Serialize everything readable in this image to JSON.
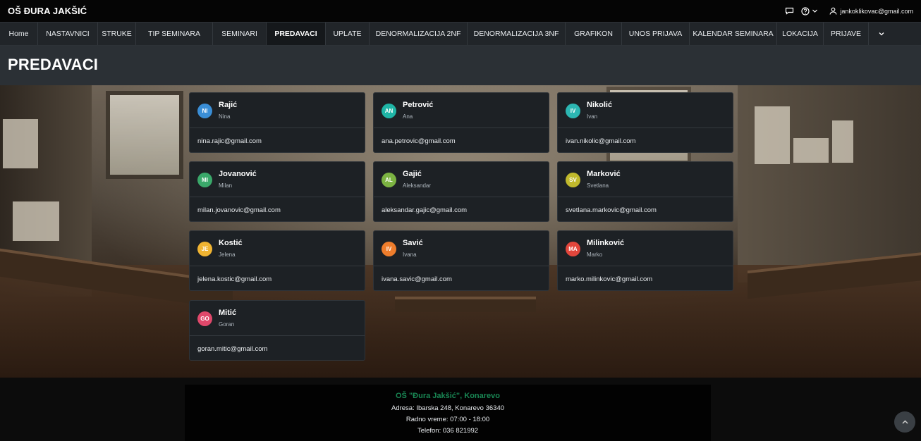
{
  "brand": "OŠ ĐURA JAKŠIĆ",
  "topbar": {
    "user_email": "jankoklikovac@gmail.com"
  },
  "nav": {
    "items": [
      {
        "label": "Home",
        "w": 54
      },
      {
        "label": "NASTAVNICI",
        "w": 85
      },
      {
        "label": "STRUKE",
        "w": 54
      },
      {
        "label": "TIP SEMINARA",
        "w": 109
      },
      {
        "label": "SEMINARI",
        "w": 76
      },
      {
        "label": "PREDAVACI",
        "w": 84,
        "active": true
      },
      {
        "label": "UPLATE",
        "w": 62
      },
      {
        "label": "DENORMALIZACIJA 2NF",
        "w": 139
      },
      {
        "label": "DENORMALIZACIJA 3NF",
        "w": 139
      },
      {
        "label": "GRAFIKON",
        "w": 80
      },
      {
        "label": "UNOS PRIJAVA",
        "w": 96
      },
      {
        "label": "KALENDAR SEMINARA",
        "w": 124
      },
      {
        "label": "LOKACIJA",
        "w": 66
      },
      {
        "label": "PRIJAVE",
        "w": 64
      }
    ]
  },
  "page": {
    "title": "PREDAVACI"
  },
  "lecturers": [
    {
      "initials": "NI",
      "lastname": "Rajić",
      "firstname": "Nina",
      "email": "nina.rajic@gmail.com",
      "color": "#3a8ed6"
    },
    {
      "initials": "AN",
      "lastname": "Petrović",
      "firstname": "Ana",
      "email": "ana.petrovic@gmail.com",
      "color": "#1fb5a6"
    },
    {
      "initials": "IV",
      "lastname": "Nikolić",
      "firstname": "Ivan",
      "email": "ivan.nikolic@gmail.com",
      "color": "#2cb6b2"
    },
    {
      "initials": "MI",
      "lastname": "Jovanović",
      "firstname": "Milan",
      "email": "milan.jovanovic@gmail.com",
      "color": "#3aa86a"
    },
    {
      "initials": "AL",
      "lastname": "Gajić",
      "firstname": "Aleksandar",
      "email": "aleksandar.gajic@gmail.com",
      "color": "#7cb342"
    },
    {
      "initials": "SV",
      "lastname": "Marković",
      "firstname": "Svetlana",
      "email": "svetlana.markovic@gmail.com",
      "color": "#c0b92c"
    },
    {
      "initials": "JE",
      "lastname": "Kostić",
      "firstname": "Jelena",
      "email": "jelena.kostic@gmail.com",
      "color": "#f0b432"
    },
    {
      "initials": "IV",
      "lastname": "Savić",
      "firstname": "Ivana",
      "email": "ivana.savic@gmail.com",
      "color": "#ee7d2c"
    },
    {
      "initials": "MA",
      "lastname": "Milinković",
      "firstname": "Marko",
      "email": "marko.milinkovic@gmail.com",
      "color": "#e2463c"
    },
    {
      "initials": "GO",
      "lastname": "Mitić",
      "firstname": "Goran",
      "email": "goran.mitic@gmail.com",
      "color": "#e0486b"
    }
  ],
  "footer": {
    "school": "OŠ \"Đura Jakšić\", Konarevo",
    "address": "Adresa: Ibarska 248, Konarevo 36340",
    "hours": "Radno vreme: 07:00 - 18:00",
    "phone": "Telefon: 036 821992"
  }
}
